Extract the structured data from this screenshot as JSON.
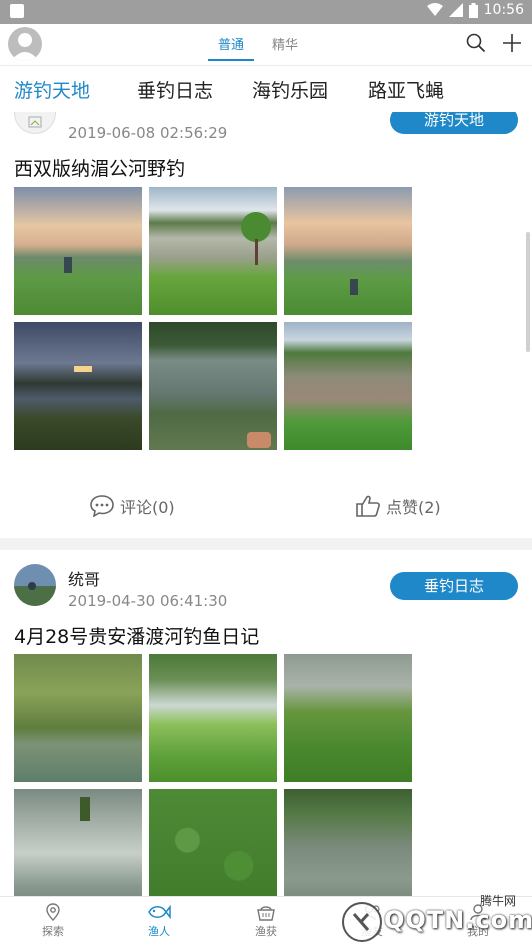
{
  "status_bar": {
    "time": "10:56"
  },
  "top_bar": {
    "tabs": [
      {
        "label": "普通",
        "active": true
      },
      {
        "label": "精华",
        "active": false
      }
    ]
  },
  "categories": [
    "游钓天地",
    "垂钓日志",
    "海钓乐园",
    "路亚飞蝇"
  ],
  "posts": [
    {
      "author": "",
      "time": "2019-06-08 02:56:29",
      "tag": "游钓天地",
      "title": "西双版纳湄公河野钓",
      "comments": "评论(0)",
      "likes": "点赞(2)"
    },
    {
      "author": "统哥",
      "time": "2019-04-30 06:41:30",
      "tag": "垂钓日志",
      "title": "4月28号贵安潘渡河钓鱼日记"
    }
  ],
  "bottom_nav": [
    {
      "label": "探索",
      "icon": "location-icon",
      "active": false
    },
    {
      "label": "渔人",
      "icon": "fish-icon",
      "active": true
    },
    {
      "label": "渔获",
      "icon": "basket-icon",
      "active": false
    },
    {
      "label": "渔友",
      "icon": "friends-icon",
      "active": false
    },
    {
      "label": "我的",
      "icon": "user-icon",
      "active": false
    }
  ],
  "watermark": {
    "text": "QQTN.com",
    "sub": "腾牛网"
  },
  "colors": {
    "accent": "#1e88c8",
    "status_bar": "#9e9e9e"
  }
}
